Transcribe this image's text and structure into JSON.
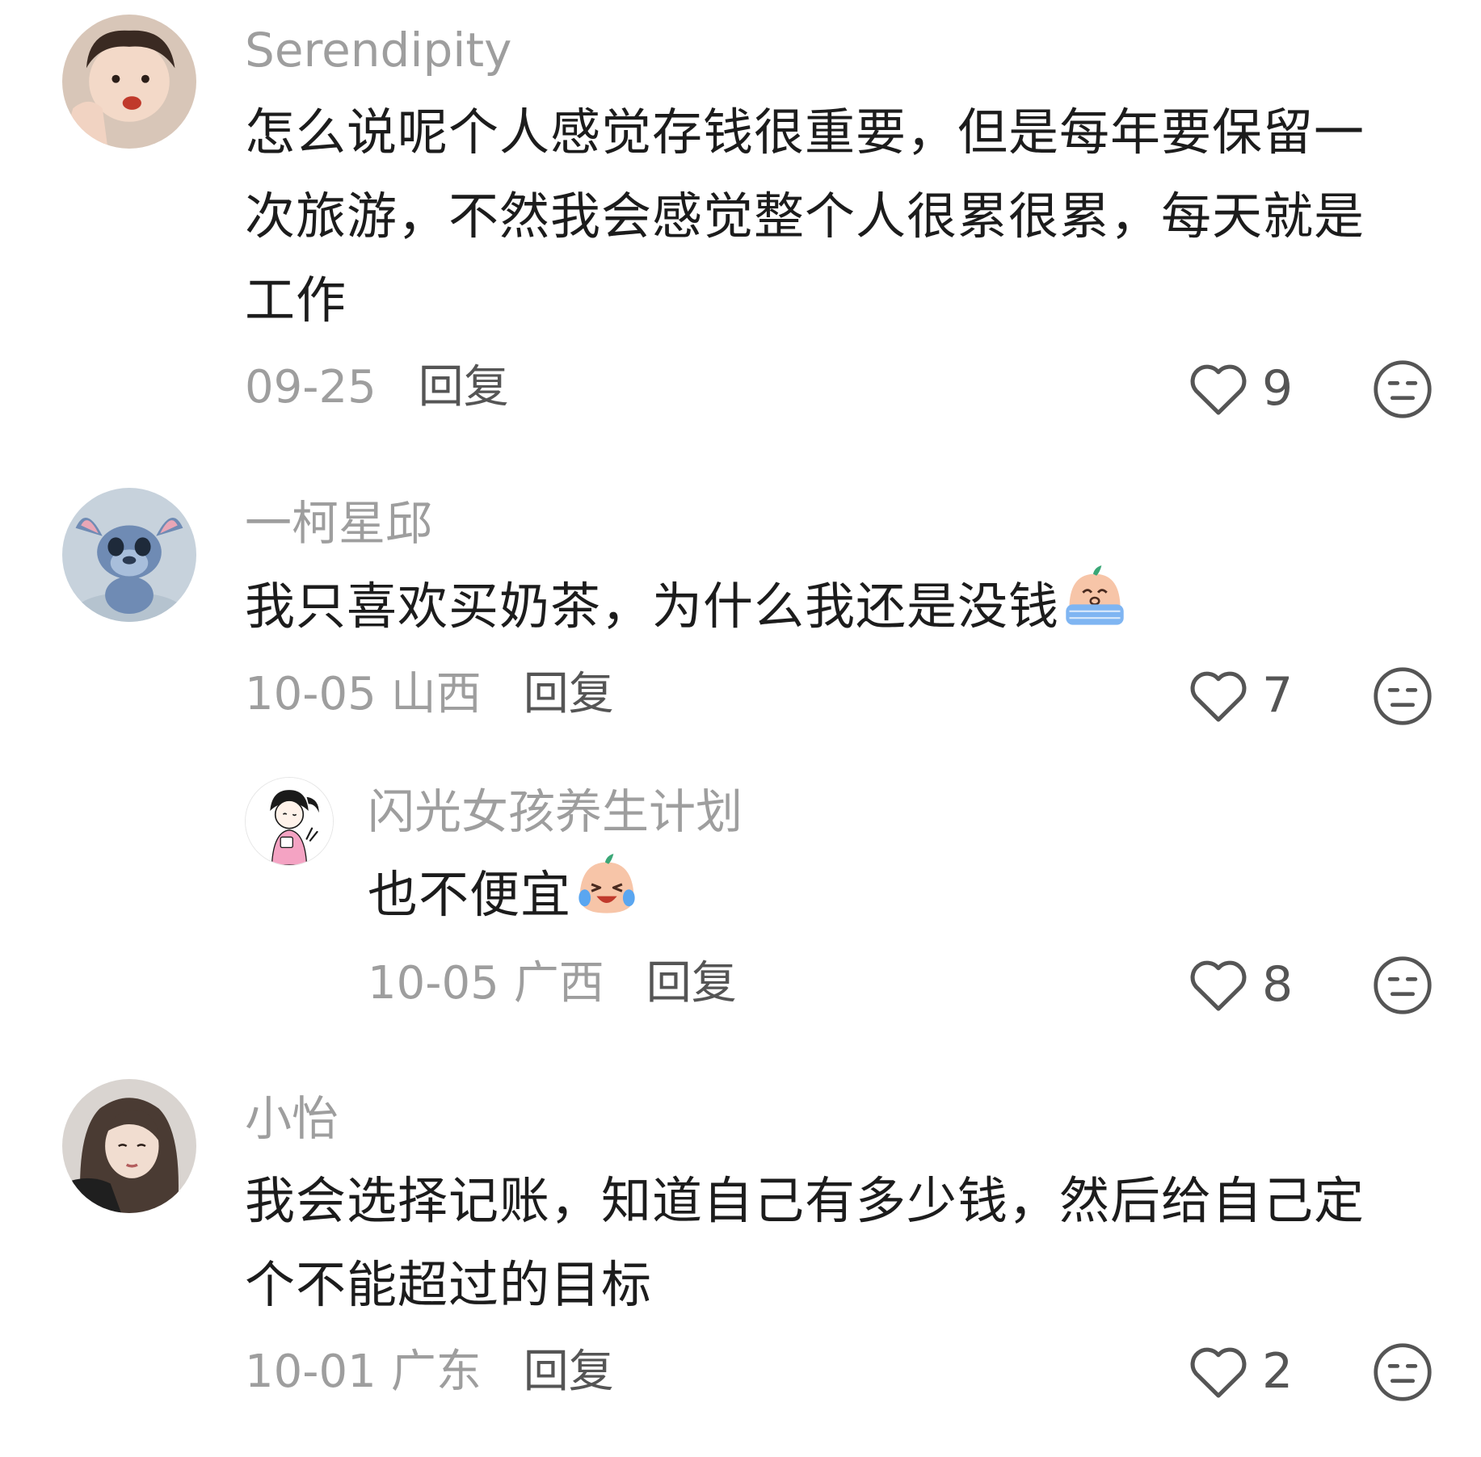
{
  "comments": [
    {
      "username": "Serendipity",
      "text": "怎么说呢个人感觉存钱很重要，但是每年要保留一次旅游，不然我会感觉整个人很累很累，每天就是工作",
      "date": "09-25",
      "region": "",
      "reply_label": "回复",
      "likes": "9"
    },
    {
      "username": "一柯星邱",
      "text": "我只喜欢买奶茶，为什么我还是没钱",
      "emoji": "crying-face-emoji",
      "date": "10-05",
      "region": "山西",
      "reply_label": "回复",
      "likes": "7"
    },
    {
      "username": "闪光女孩养生计划",
      "text": "也不便宜",
      "emoji": "laughing-tears-emoji",
      "date": "10-05",
      "region": "广西",
      "reply_label": "回复",
      "likes": "8"
    },
    {
      "username": "小怡",
      "text": "我会选择记账，知道自己有多少钱，然后给自己定个不能超过的目标",
      "date": "10-01",
      "region": "广东",
      "reply_label": "回复",
      "likes": "2"
    }
  ],
  "icons": {
    "like": "heart-outline-icon",
    "dislike": "meh-face-icon"
  },
  "colors": {
    "username": "#9e9e9e",
    "body_text": "#1c1c1c",
    "meta": "#9e9e9e",
    "reply": "#555555"
  }
}
